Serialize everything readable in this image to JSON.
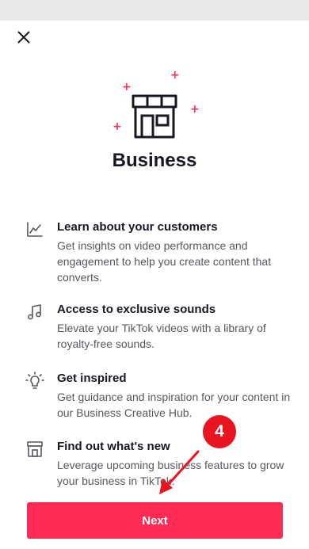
{
  "title": "Business",
  "colors": {
    "accent": "#fe2c55",
    "annotation": "#e8141f",
    "text": "#161823",
    "muted": "#57585f"
  },
  "sparkle_glyph": "+",
  "features": [
    {
      "icon": "chart-line-icon",
      "title": "Learn about your customers",
      "description": "Get insights on video performance and engagement to help you create content that converts."
    },
    {
      "icon": "music-note-icon",
      "title": "Access to exclusive sounds",
      "description": "Elevate your TikTok videos with a library of royalty-free sounds."
    },
    {
      "icon": "lightbulb-icon",
      "title": "Get inspired",
      "description": "Get guidance and inspiration for your content in our Business Creative Hub."
    },
    {
      "icon": "store-icon",
      "title": "Find out what's new",
      "description": "Leverage upcoming business features to grow your business in TikTok."
    }
  ],
  "next_label": "Next",
  "annotation": {
    "step": "4"
  }
}
